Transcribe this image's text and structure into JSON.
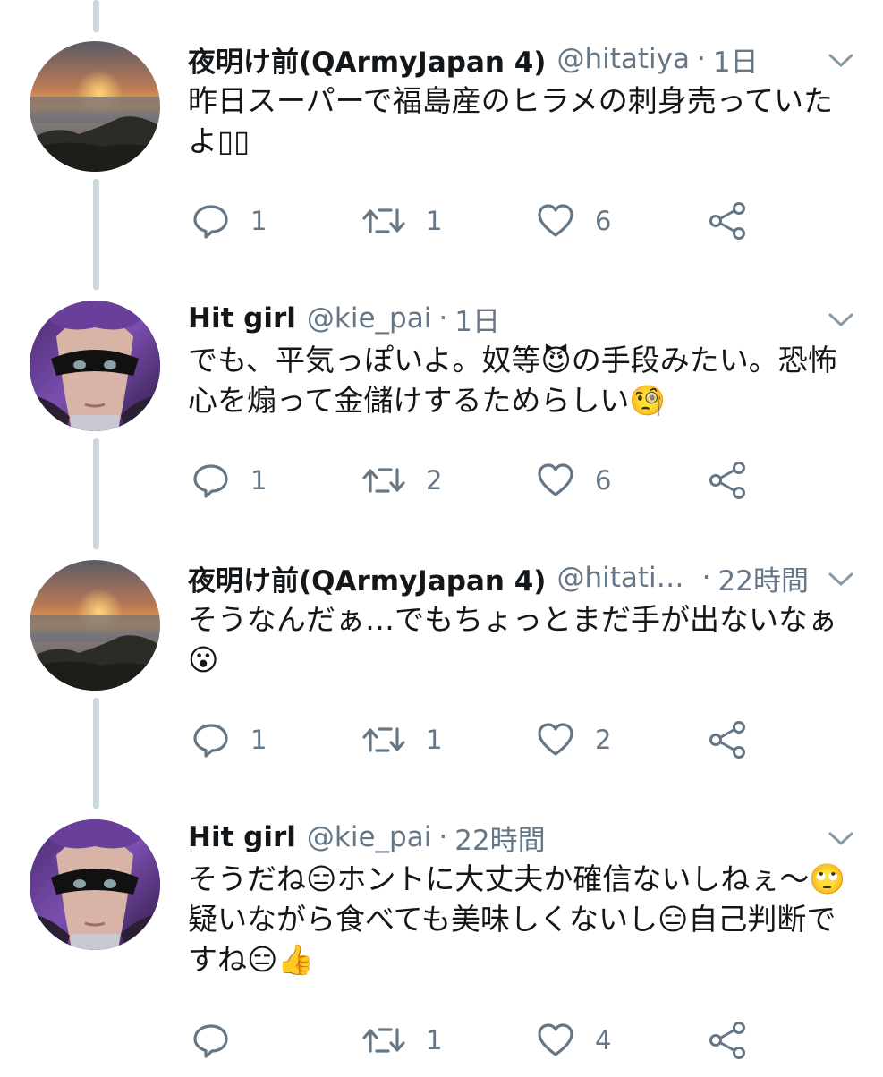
{
  "colors": {
    "text": "#14171a",
    "secondary": "#657786",
    "thread_line": "#ccd6dd"
  },
  "tweets": [
    {
      "avatar": "sunset-avatar",
      "name": "夜明け前(QArmyJapan 4)",
      "handle": "@hitatiya",
      "dot": "·",
      "time": "1日",
      "text": "昨日スーパーで福島産のヒラメの刺身売っていたよ▯▯",
      "reply_count": "1",
      "retweet_count": "1",
      "like_count": "6"
    },
    {
      "avatar": "masked-girl-avatar",
      "name": "Hit girl",
      "handle": "@kie_pai",
      "dot": "·",
      "time": "1日",
      "text": "でも、平気っぽいよ。奴等😈の手段みたい。恐怖心を煽って金儲けするためらしい🧐",
      "reply_count": "1",
      "retweet_count": "2",
      "like_count": "6"
    },
    {
      "avatar": "sunset-avatar",
      "name": "夜明け前(QArmyJapan 4)",
      "handle": "@hitati…",
      "dot": "·",
      "time": "22時間",
      "text": "そうなんだぁ…でもちょっとまだ手が出ないなぁ😮",
      "reply_count": "1",
      "retweet_count": "1",
      "like_count": "2"
    },
    {
      "avatar": "masked-girl-avatar",
      "name": "Hit girl",
      "handle": "@kie_pai",
      "dot": "·",
      "time": "22時間",
      "text": "そうだね😑ホントに大丈夫か確信ないしねぇ〜🙄疑いながら食べても美味しくないし😑自己判断ですね😑👍",
      "reply_count": "",
      "retweet_count": "1",
      "like_count": "4"
    }
  ]
}
